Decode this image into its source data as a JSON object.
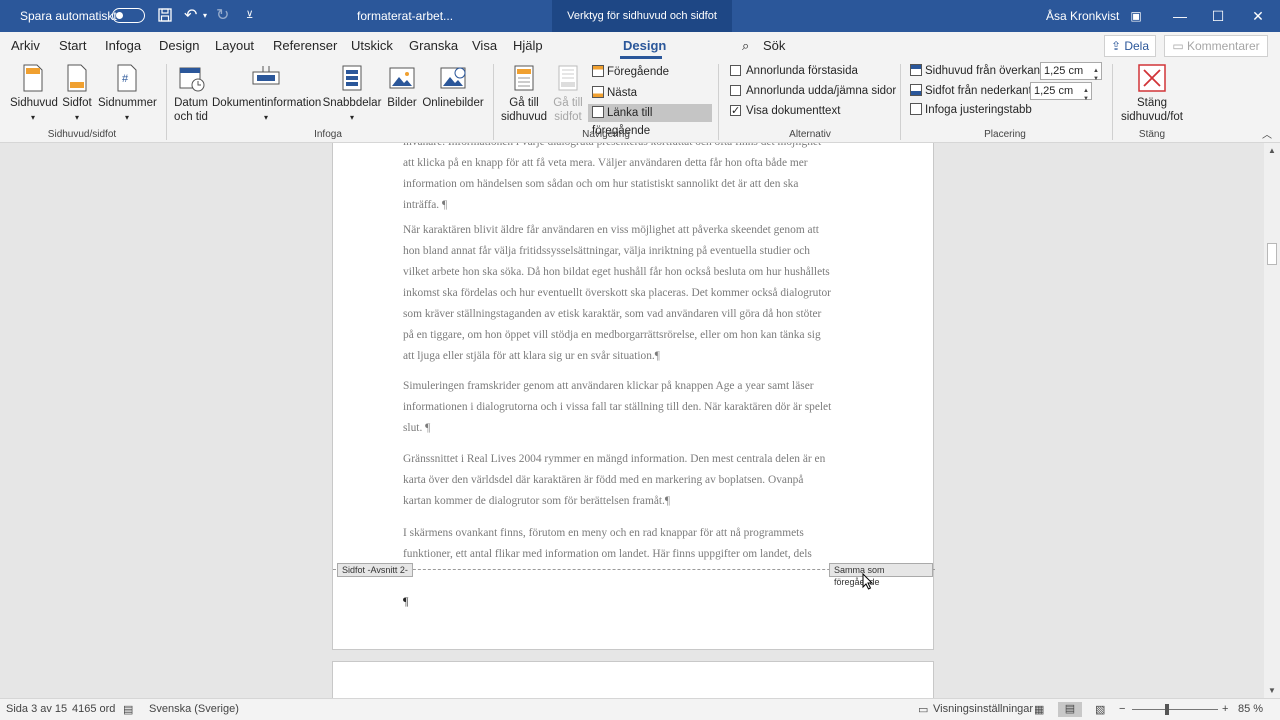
{
  "titlebar": {
    "autosave_label": "Spara automatiskt",
    "filename": "formaterat-arbet...",
    "context_tab": "Verktyg för sidhuvud och sidfot",
    "user": "Åsa Kronkvist"
  },
  "menu": {
    "tabs": [
      "Arkiv",
      "Start",
      "Infoga",
      "Design",
      "Layout",
      "Referenser",
      "Utskick",
      "Granska",
      "Visa",
      "Hjälp",
      "Design"
    ],
    "search_label": "Sök",
    "share_label": "Dela",
    "comments_label": "Kommentarer"
  },
  "ribbon": {
    "hf_group": {
      "label": "Sidhuvud/sidfot",
      "header": "Sidhuvud",
      "footer": "Sidfot",
      "page_number": "Sidnummer"
    },
    "insert_group": {
      "label": "Infoga",
      "date_time_1": "Datum",
      "date_time_2": "och tid",
      "doc_info": "Dokumentinformation",
      "quick_parts": "Snabbdelar",
      "pictures": "Bilder",
      "online_pictures": "Onlinebilder"
    },
    "nav_group": {
      "label": "Navigering",
      "goto_header_1": "Gå till",
      "goto_header_2": "sidhuvud",
      "goto_footer_1": "Gå till",
      "goto_footer_2": "sidfot",
      "previous": "Föregående",
      "next": "Nästa",
      "link_previous": "Länka till föregående"
    },
    "options_group": {
      "label": "Alternativ",
      "diff_first": "Annorlunda förstasida",
      "diff_odd_even": "Annorlunda udda/jämna sidor",
      "show_doc_text": "Visa dokumenttext"
    },
    "position_group": {
      "label": "Placering",
      "header_from_top": "Sidhuvud från överkant:",
      "header_value": "1,25 cm",
      "footer_from_bottom": "Sidfot från nederkant:",
      "footer_value": "1,25 cm",
      "insert_tab": "Infoga justeringstabb"
    },
    "close_group": {
      "label": "Stäng",
      "close_1": "Stäng",
      "close_2": "sidhuvud/fot"
    }
  },
  "document": {
    "lines_p1": [
      "invånare. Informationen i varje dialogruta presenteras kortfattat och ofta finns det möjlighet",
      "att klicka på en knapp för att få veta mera. Väljer användaren detta får hon ofta både mer",
      "information om händelsen som sådan och om hur statistiskt sannolikt det är att den ska",
      "inträffa. ¶"
    ],
    "lines_p2": [
      "När karaktären blivit äldre får användaren en viss möjlighet att påverka skeendet genom att",
      "hon bland annat får välja fritidssysselsättningar, välja inriktning på eventuella studier och",
      "vilket arbete hon ska söka. Då hon bildat eget hushåll får hon också besluta om hur hushållets",
      "inkomst ska fördelas och hur eventuellt överskott ska placeras. Det kommer också dialogrutor",
      "som kräver ställningstaganden av etisk karaktär, som vad användaren vill göra då hon stöter",
      "på en tiggare, om hon öppet vill stödja en medborgarrättsrörelse, eller om hon kan tänka sig",
      "att ljuga eller stjäla för att klara sig ur en svår situation.¶"
    ],
    "lines_p3": [
      "Simuleringen framskrider genom att användaren klickar på knappen Age a year samt läser",
      "informationen i dialogrutorna och i vissa fall tar ställning till den. När karaktären dör är spelet",
      "slut. ¶"
    ],
    "lines_p4": [
      "Gränssnittet i Real Lives 2004 rymmer en mängd information. Den mest centrala delen är en",
      "karta över den världsdel där karaktären är född med en markering av boplatsen. Ovanpå",
      "kartan kommer de dialogrutor som för berättelsen framåt.¶"
    ],
    "lines_p5": [
      "I skärmens ovankant finns, förutom en meny och en rad knappar för att nå programmets",
      "funktioner, ett antal flikar med information om landet. Här finns uppgifter om landet, dels"
    ],
    "footer_tag": "Sidfot -Avsnitt 2-",
    "same_as_previous": "Samma som föregående",
    "pilcrow": "¶"
  },
  "status": {
    "page": "Sida 3 av 15",
    "words": "4165 ord",
    "language": "Svenska (Sverige)",
    "display_settings": "Visningsinställningar",
    "zoom": "85 %"
  }
}
